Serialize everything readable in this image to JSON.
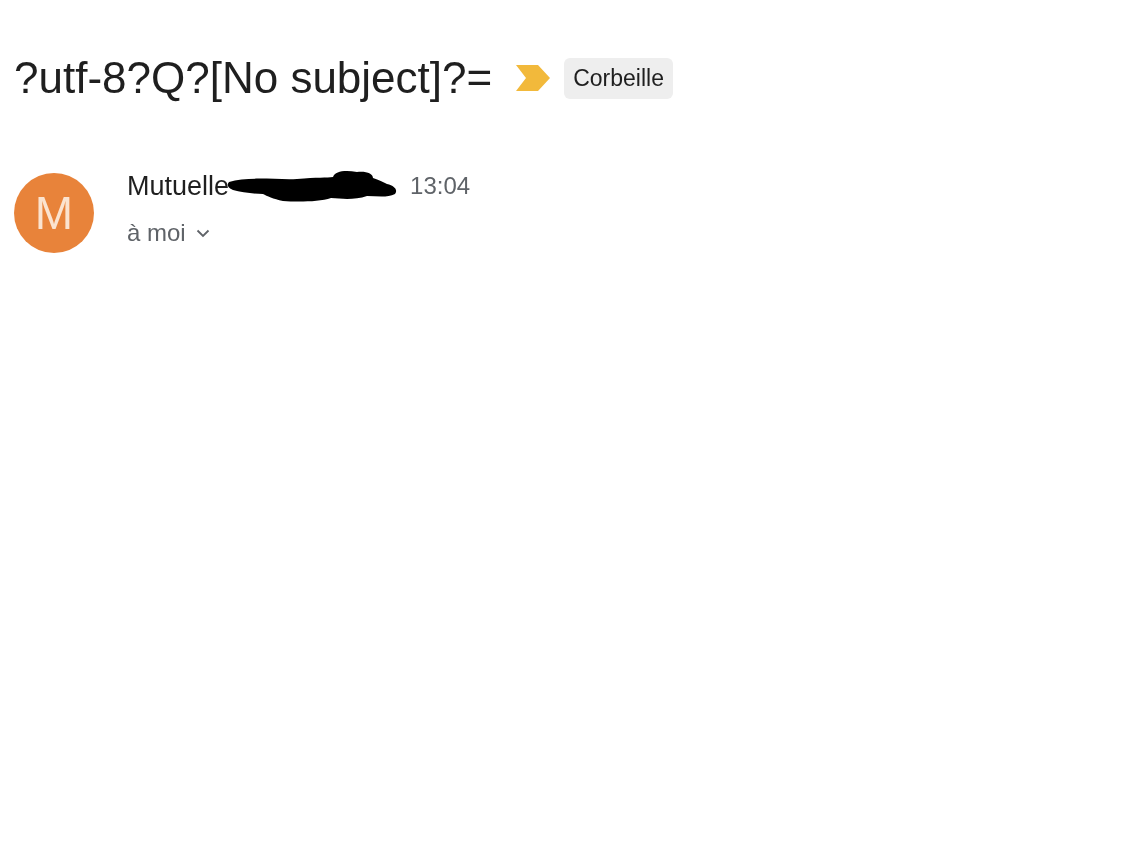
{
  "message": {
    "subject": "?utf-8?Q?[No subject]?=",
    "important": true,
    "labels": [
      {
        "label": "Corbeille"
      }
    ],
    "sender": {
      "initial": "M",
      "name": "Mutuelle",
      "redacted": true,
      "time": "13:04",
      "recipient": "à moi"
    }
  }
}
